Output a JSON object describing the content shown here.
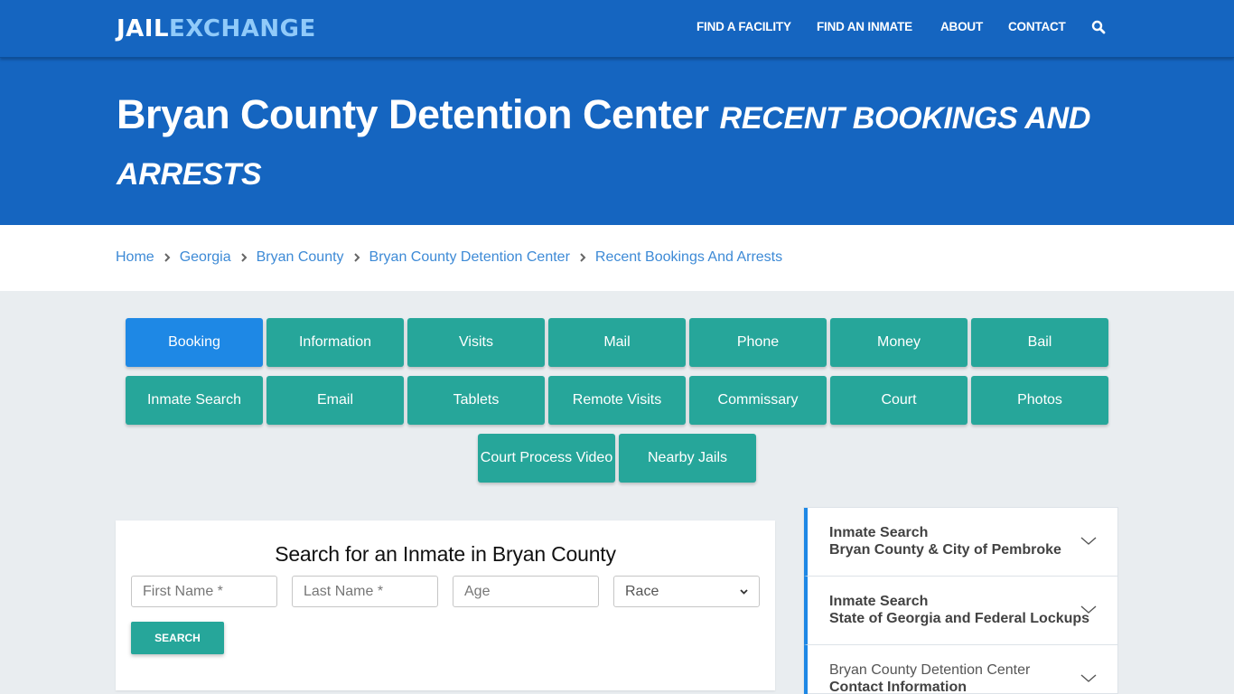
{
  "brand": {
    "part1": "JAIL",
    "part2": "EXCHANGE"
  },
  "nav": {
    "items": [
      "FIND A FACILITY",
      "FIND AN INMATE",
      "ABOUT",
      "CONTACT"
    ],
    "search_icon": "search-icon"
  },
  "hero": {
    "title": "Bryan County Detention Center",
    "subtitle": "Recent Bookings And Arrests"
  },
  "breadcrumb": [
    "Home",
    "Georgia",
    "Bryan County",
    "Bryan County Detention Center",
    "Recent Bookings And Arrests"
  ],
  "tabs": {
    "active": "Booking",
    "row1": [
      "Booking",
      "Information",
      "Visits",
      "Mail",
      "Phone",
      "Money",
      "Bail"
    ],
    "row2": [
      "Inmate Search",
      "Email",
      "Tablets",
      "Remote Visits",
      "Commissary",
      "Court",
      "Photos"
    ],
    "row3": [
      "Court Process Video",
      "Nearby Jails"
    ]
  },
  "search": {
    "title": "Search for an Inmate in Bryan County",
    "first_name_placeholder": "First Name *",
    "last_name_placeholder": "Last Name *",
    "age_placeholder": "Age",
    "race_selected": "Race",
    "button_label": "SEARCH"
  },
  "sidebar": {
    "items": [
      {
        "line1": "Inmate Search",
        "line2": "Bryan County & City of Pembroke"
      },
      {
        "line1": "Inmate Search",
        "line2": "State of Georgia and Federal Lockups"
      },
      {
        "line1": "Bryan County Detention Center",
        "line2": "Contact Information"
      }
    ]
  },
  "colors": {
    "brand_blue": "#1565c0",
    "logo_accent": "#90caf9",
    "teal": "#26a69a",
    "active_blue": "#1e88e5",
    "link_blue": "#3d8ad6",
    "page_bg": "#e9edf0"
  }
}
